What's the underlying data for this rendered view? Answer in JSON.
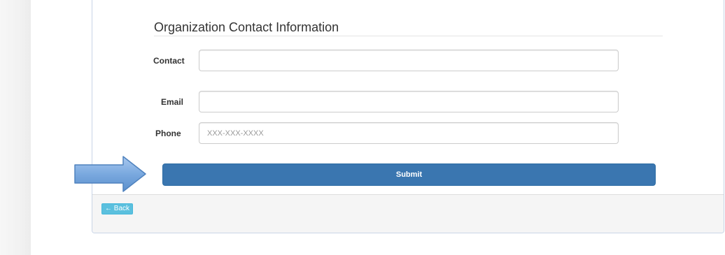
{
  "section": {
    "title": "Organization Contact Information"
  },
  "form": {
    "contact": {
      "label": "Contact",
      "value": "",
      "placeholder": ""
    },
    "email": {
      "label": "Email",
      "value": "",
      "placeholder": ""
    },
    "phone": {
      "label": "Phone",
      "value": "",
      "placeholder": "XXX-XXX-XXXX"
    }
  },
  "actions": {
    "submit_label": "Submit",
    "back_label": "← Back"
  },
  "annotation": {
    "icon": "right-arrow-icon",
    "color": "#6a9ed8"
  },
  "colors": {
    "primary": "#3a76b0",
    "info": "#5bc0de"
  }
}
